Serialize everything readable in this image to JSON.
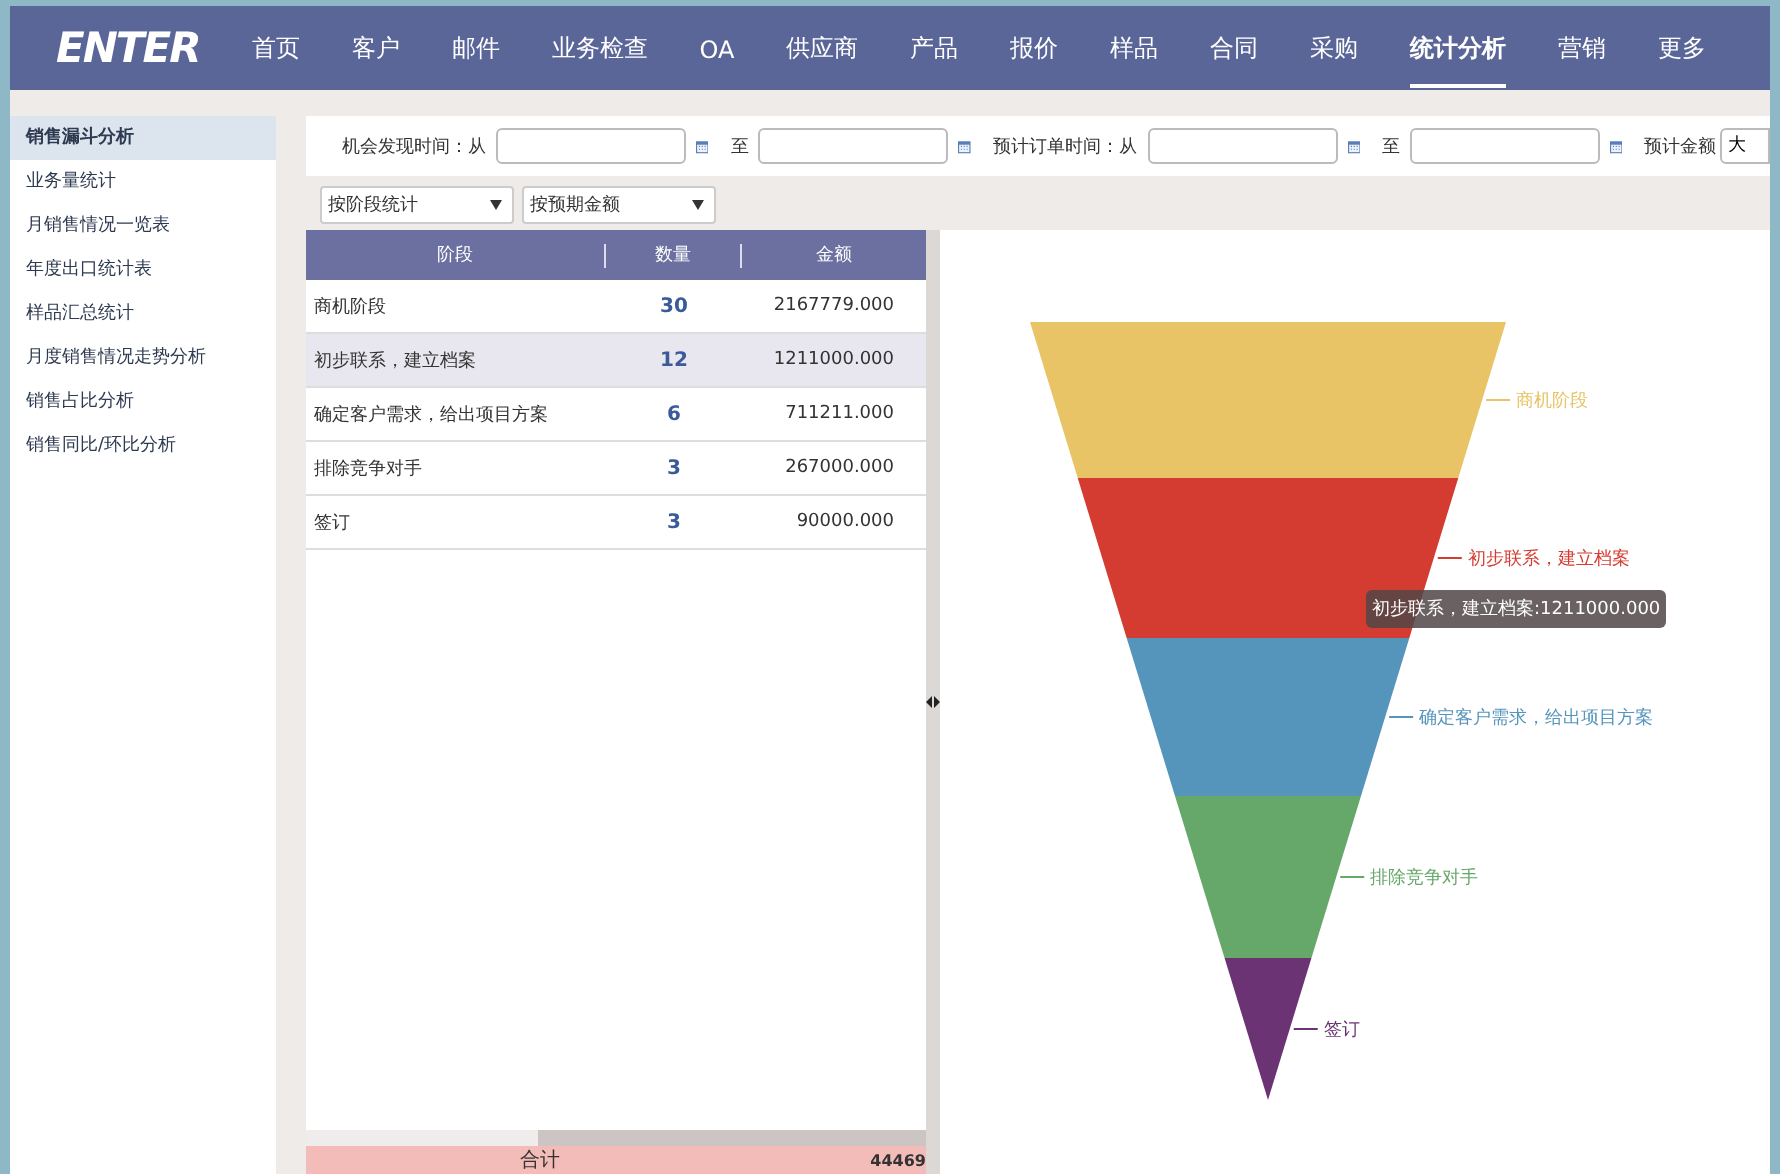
{
  "nav": {
    "logo": "ENTER",
    "items": [
      {
        "label": "首页",
        "selected": false
      },
      {
        "label": "客户",
        "selected": false
      },
      {
        "label": "邮件",
        "selected": false
      },
      {
        "label": "业务检查",
        "selected": false
      },
      {
        "label": "OA",
        "selected": false
      },
      {
        "label": "供应商",
        "selected": false
      },
      {
        "label": "产品",
        "selected": false
      },
      {
        "label": "报价",
        "selected": false
      },
      {
        "label": "样品",
        "selected": false
      },
      {
        "label": "合同",
        "selected": false
      },
      {
        "label": "采购",
        "selected": false
      },
      {
        "label": "统计分析",
        "selected": true
      },
      {
        "label": "营销",
        "selected": false
      },
      {
        "label": "更多",
        "selected": false
      }
    ]
  },
  "sidebar": {
    "items": [
      {
        "label": "销售漏斗分析",
        "selected": true
      },
      {
        "label": "业务量统计",
        "selected": false
      },
      {
        "label": "月销售情况一览表",
        "selected": false
      },
      {
        "label": "年度出口统计表",
        "selected": false
      },
      {
        "label": "样品汇总统计",
        "selected": false
      },
      {
        "label": "月度销售情况走势分析",
        "selected": false
      },
      {
        "label": "销售占比分析",
        "selected": false
      },
      {
        "label": "销售同比/环比分析",
        "selected": false
      }
    ]
  },
  "filters": [
    {
      "kind": "label",
      "text": "机会发现时间：从"
    },
    {
      "kind": "date"
    },
    {
      "kind": "label",
      "text": "至"
    },
    {
      "kind": "date"
    },
    {
      "kind": "label",
      "text": "预计订单时间：从"
    },
    {
      "kind": "date"
    },
    {
      "kind": "label",
      "text": "至"
    },
    {
      "kind": "date"
    },
    {
      "kind": "label",
      "text": "预计金额"
    },
    {
      "kind": "select",
      "value": "大"
    }
  ],
  "selects": [
    {
      "value": "按阶段统计"
    },
    {
      "value": "按预期金额"
    }
  ],
  "table": {
    "columns": [
      "阶段",
      "数量",
      "金额"
    ],
    "rows": [
      {
        "cells": [
          "商机阶段",
          "30",
          "2167779.000"
        ],
        "selected": false
      },
      {
        "cells": [
          "初步联系，建立档案",
          "12",
          "1211000.000"
        ],
        "selected": true
      },
      {
        "cells": [
          "确定客户需求，给出项目方案",
          "6",
          "711211.000"
        ],
        "selected": false
      },
      {
        "cells": [
          "排除竞争对手",
          "3",
          "267000.000"
        ],
        "selected": false
      },
      {
        "cells": [
          "签订",
          "3",
          "90000.000"
        ],
        "selected": false
      }
    ],
    "total": {
      "label": "合计",
      "value": "44469"
    }
  },
  "chart": {
    "stages": [
      {
        "label": "商机阶段",
        "color": "#e8c466"
      },
      {
        "label": "初步联系，建立档案",
        "color": "#d43c31"
      },
      {
        "label": "确定客户需求，给出项目方案",
        "color": "#5594bb"
      },
      {
        "label": "排除竞争对手",
        "color": "#65a86a"
      },
      {
        "label": "签订",
        "color": "#6b3374"
      }
    ],
    "tooltip": "初步联系，建立档案:1211000.000"
  }
}
